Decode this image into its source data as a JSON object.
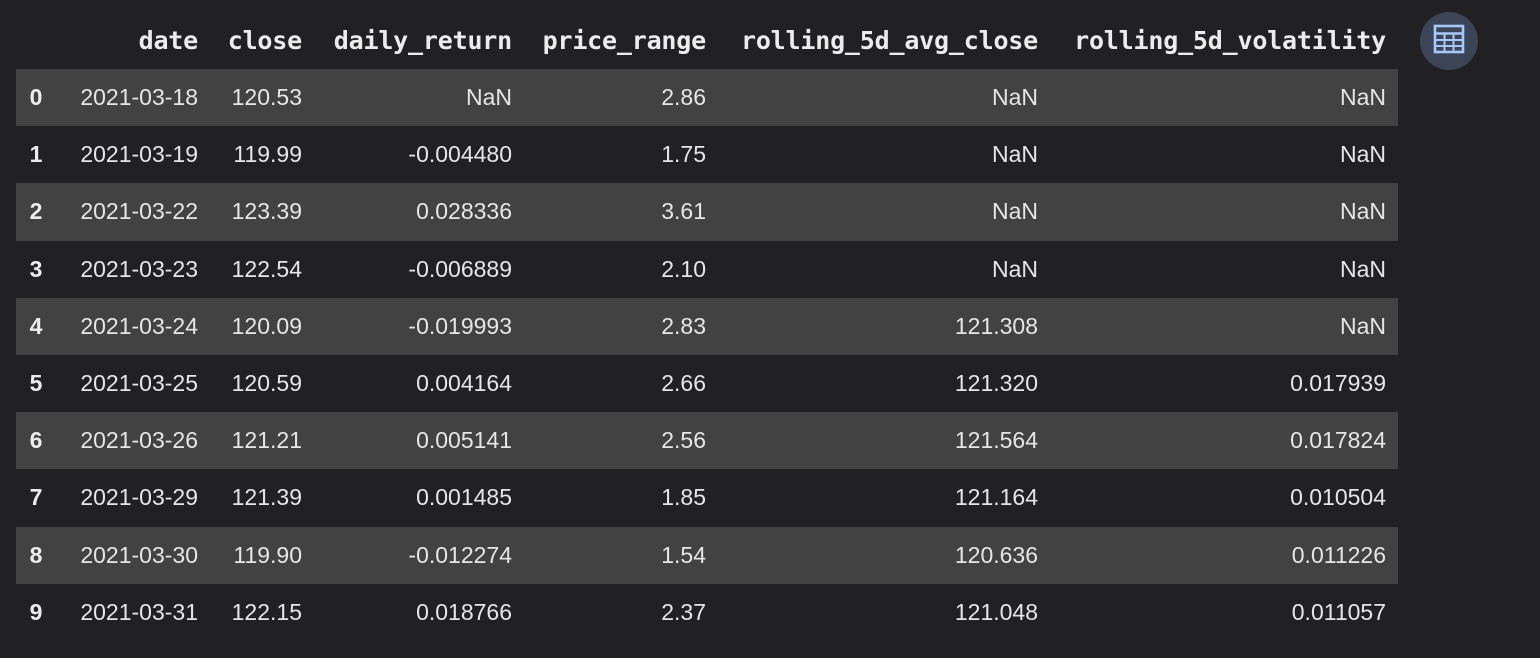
{
  "dataframe": {
    "columns": [
      "",
      "date",
      "close",
      "daily_return",
      "price_range",
      "rolling_5d_avg_close",
      "rolling_5d_volatility"
    ],
    "rows": [
      {
        "index": "0",
        "cells": [
          "2021-03-18",
          "120.53",
          "NaN",
          "2.86",
          "NaN",
          "NaN"
        ]
      },
      {
        "index": "1",
        "cells": [
          "2021-03-19",
          "119.99",
          "-0.004480",
          "1.75",
          "NaN",
          "NaN"
        ]
      },
      {
        "index": "2",
        "cells": [
          "2021-03-22",
          "123.39",
          "0.028336",
          "3.61",
          "NaN",
          "NaN"
        ]
      },
      {
        "index": "3",
        "cells": [
          "2021-03-23",
          "122.54",
          "-0.006889",
          "2.10",
          "NaN",
          "NaN"
        ]
      },
      {
        "index": "4",
        "cells": [
          "2021-03-24",
          "120.09",
          "-0.019993",
          "2.83",
          "121.308",
          "NaN"
        ]
      },
      {
        "index": "5",
        "cells": [
          "2021-03-25",
          "120.59",
          "0.004164",
          "2.66",
          "121.320",
          "0.017939"
        ]
      },
      {
        "index": "6",
        "cells": [
          "2021-03-26",
          "121.21",
          "0.005141",
          "2.56",
          "121.564",
          "0.017824"
        ]
      },
      {
        "index": "7",
        "cells": [
          "2021-03-29",
          "121.39",
          "0.001485",
          "1.85",
          "121.164",
          "0.010504"
        ]
      },
      {
        "index": "8",
        "cells": [
          "2021-03-30",
          "119.90",
          "-0.012274",
          "1.54",
          "120.636",
          "0.011226"
        ]
      },
      {
        "index": "9",
        "cells": [
          "2021-03-31",
          "122.15",
          "0.018766",
          "2.37",
          "121.048",
          "0.011057"
        ]
      }
    ]
  },
  "toolbar": {
    "table_view_icon": "table-grid-icon"
  },
  "colors": {
    "background": "#212124",
    "stripe_row": "#424242",
    "text": "#e3e3e3",
    "icon_button_bg": "#3b4557",
    "icon_color": "#a8c7fa"
  }
}
